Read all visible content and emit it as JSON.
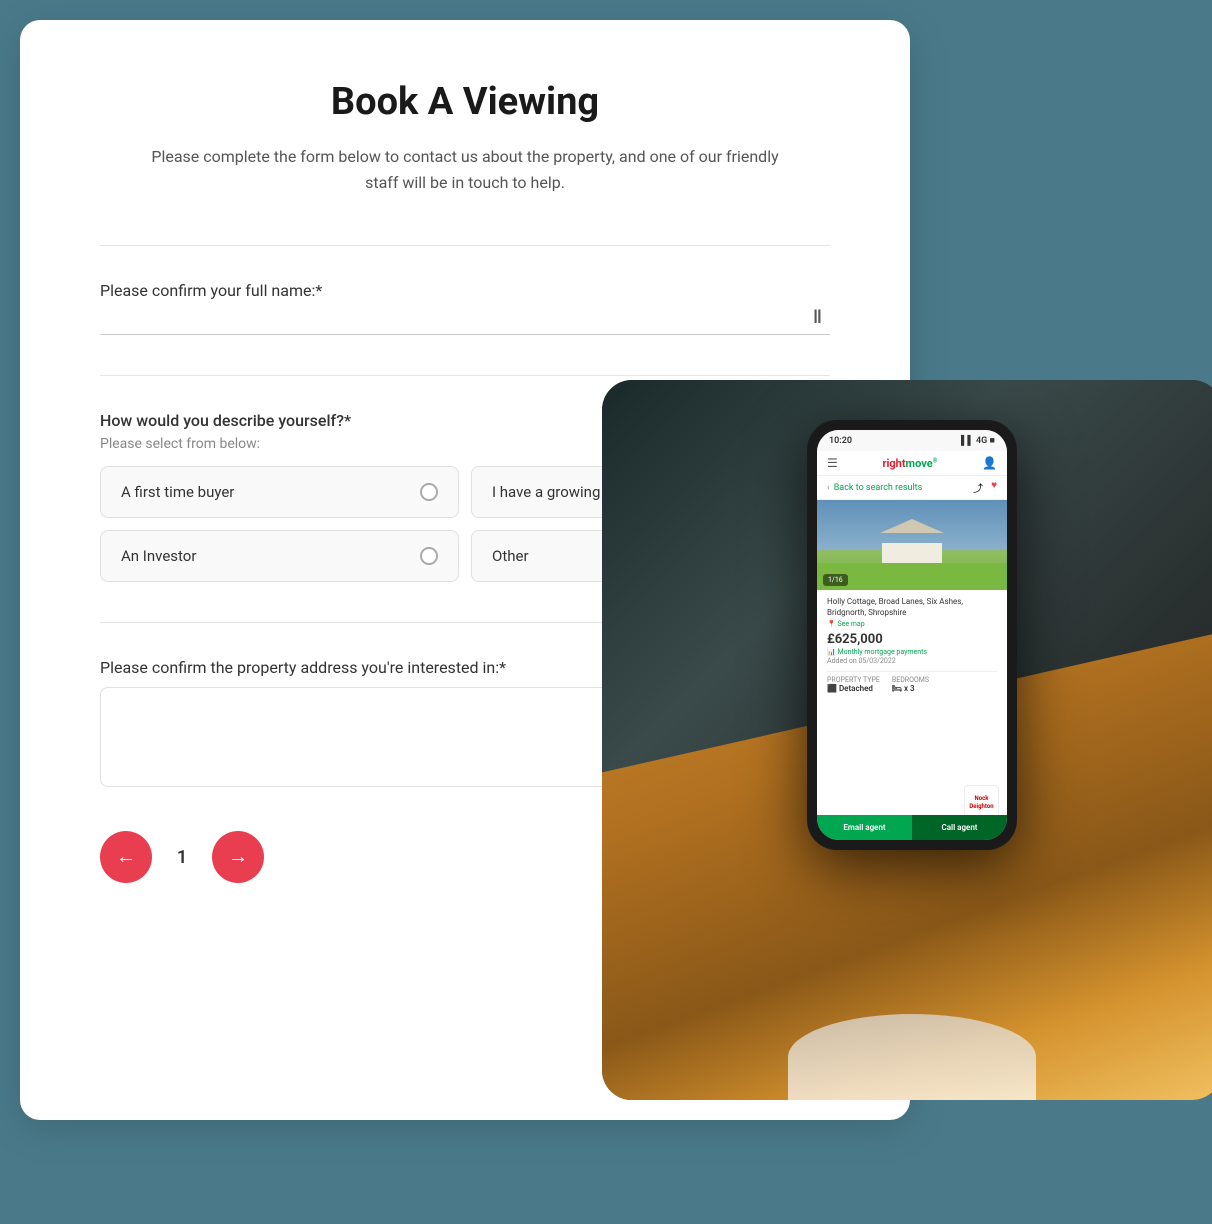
{
  "page": {
    "background_color": "#4a7a8a"
  },
  "form": {
    "title": "Book A Viewing",
    "subtitle": "Please complete the form below to contact us about the property, and one of our friendly staff will be in touch to help.",
    "name_field": {
      "label": "Please confirm your full name:*",
      "placeholder": "",
      "value": ""
    },
    "describe_section": {
      "label": "How would you describe yourself?*",
      "sublabel": "Please select from below:",
      "options": [
        {
          "id": "first-time-buyer",
          "label": "A first time buyer"
        },
        {
          "id": "growing-family",
          "label": "I have a growing family"
        },
        {
          "id": "investor",
          "label": "An Investor"
        },
        {
          "id": "other",
          "label": "Other"
        }
      ]
    },
    "address_field": {
      "label": "Please confirm the property address you're interested in:*",
      "placeholder": ""
    },
    "pagination": {
      "prev_label": "←",
      "current_page": "1",
      "next_label": "→"
    }
  },
  "phone": {
    "status_time": "10:20",
    "app_name": "rightmove",
    "back_text": "Back to search results",
    "property": {
      "address": "Holly Cottage, Broad Lanes, Six Ashes, Bridgnorth, Shropshire",
      "see_map": "See map",
      "price": "£625,000",
      "mortgage_text": "Monthly mortgage payments",
      "added_text": "Added on 05/03/2022",
      "img_counter": "1/16",
      "property_type_label": "PROPERTY TYPE",
      "property_type_value": "Detached",
      "bedrooms_label": "BEDROOMS",
      "bedrooms_value": "x 3",
      "agent_name": "Nock\nDeighton"
    },
    "cta": {
      "email_label": "Email agent",
      "call_label": "Call agent"
    }
  }
}
